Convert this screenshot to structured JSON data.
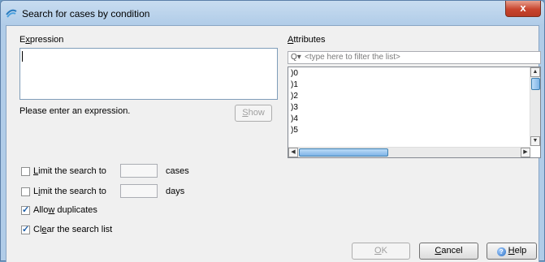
{
  "window": {
    "title": "Search for cases by condition",
    "close_glyph": "x"
  },
  "expression": {
    "label_pre": "E",
    "label_u": "x",
    "label_post": "pression",
    "value": "",
    "hint": "Please enter an expression."
  },
  "show_button": {
    "label_u": "S",
    "label_post": "how"
  },
  "attributes": {
    "label_u": "A",
    "label_post": "ttributes",
    "filter_placeholder": "<type here to filter the list>",
    "filter_icon": "Q▾",
    "items": [
      ")0",
      ")1",
      ")2",
      ")3",
      ")4",
      ")5"
    ]
  },
  "options": {
    "limit_cases": {
      "checked": false,
      "label_pre": "",
      "label_u": "L",
      "label_post": "imit the search to",
      "value": "",
      "unit": "cases"
    },
    "limit_days": {
      "checked": false,
      "label_pre": "L",
      "label_u": "i",
      "label_post": "mit the search to",
      "value": "",
      "unit": "days"
    },
    "allow_duplicates": {
      "checked": true,
      "label_pre": "Allo",
      "label_u": "w",
      "label_post": " duplicates"
    },
    "clear_list": {
      "checked": true,
      "label_pre": "Cl",
      "label_u": "e",
      "label_post": "ar the search list"
    }
  },
  "footer": {
    "ok": {
      "label_u": "O",
      "label_post": "K"
    },
    "cancel": {
      "label_u": "C",
      "label_post": "ancel"
    },
    "help": {
      "label_u": "H",
      "label_post": "elp"
    }
  },
  "colors": {
    "title_bar": "#b0cce8",
    "close": "#c8452e",
    "accent": "#3c7fb1"
  }
}
